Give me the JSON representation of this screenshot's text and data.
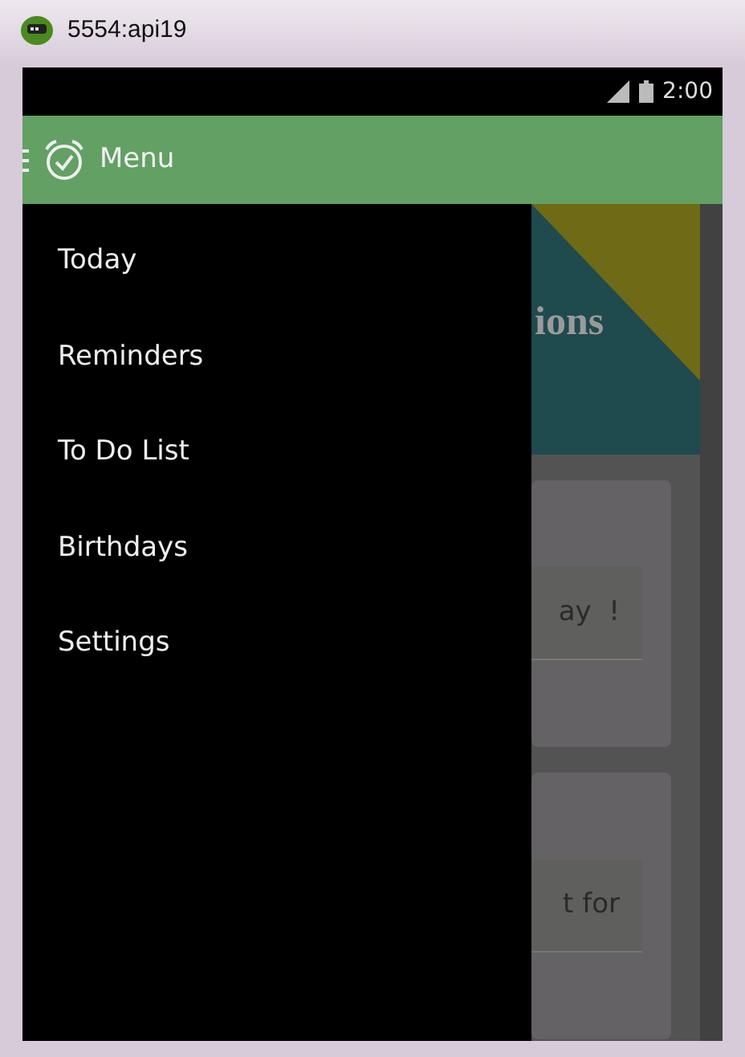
{
  "window": {
    "title": "5554:api19"
  },
  "status_bar": {
    "time": "2:00"
  },
  "action_bar": {
    "title": "Menu"
  },
  "drawer": {
    "items": [
      {
        "label": "Today"
      },
      {
        "label": "Reminders"
      },
      {
        "label": "To Do List"
      },
      {
        "label": "Birthdays"
      },
      {
        "label": "Settings"
      }
    ]
  },
  "background": {
    "banner_text": "ions",
    "cards": [
      {
        "text": "ay  !"
      },
      {
        "text": "t for"
      }
    ]
  }
}
